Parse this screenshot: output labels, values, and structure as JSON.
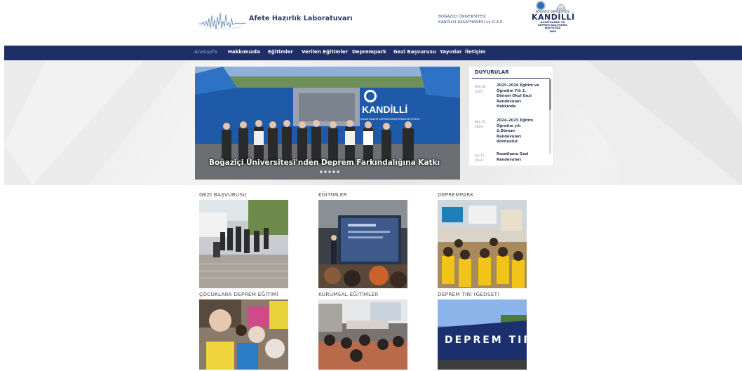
{
  "header": {
    "site_title": "Afete Hazırlık Laboratuvarı",
    "institution_line1": "BOĞAZİÇİ ÜNİVERSİTESİ",
    "institution_line2": "KANDİLLİ RASATHANESİ ve D.A.E.",
    "logo_top": "BOĞAZİÇİ ÜNİVERSİTESİ",
    "logo_main": "KANDİLLİ",
    "logo_sub1": "RASATHANESİ VE",
    "logo_sub2": "DEPREM ARAŞTIRMA",
    "logo_sub3": "ENSTİTÜSÜ",
    "logo_year": "1868"
  },
  "nav": {
    "items": [
      {
        "label": "Anasayfa"
      },
      {
        "label": "Hakkımızda"
      },
      {
        "label": "Eğitimler"
      },
      {
        "label": "Verilen Eğitimler"
      },
      {
        "label": "Deprempark"
      },
      {
        "label": "Gezi Başvurusu"
      },
      {
        "label": "Yayınlar"
      },
      {
        "label": "İletişim"
      }
    ]
  },
  "slider": {
    "caption": "Boğaziçi Üniversitesi'nden Deprem Farkındalığına Katkı",
    "tent_brand": "KANDİLLİ",
    "tent_sub": "RASATHANESİ DEPREM ARAŞTIRMA ENSTİTÜSÜ"
  },
  "announcements": {
    "title": "DUYURULAR",
    "items": [
      {
        "date1": "Tem 02",
        "date2": "2025",
        "text": "2025–2026 Eğitim ve Öğretim Yılı 2. Dönem Okul Gezi Randevuları Hakkında"
      },
      {
        "date1": "Kas 15",
        "date2": "2024",
        "text": "2024–2025 Eğitim Öğretim yılı 2.Dönem Randevuları dolmuştur."
      },
      {
        "date1": "Eyl 11",
        "date2": "2024",
        "text": "Rasathane Gezi Randevuları"
      }
    ]
  },
  "cards": [
    {
      "title": "GEZİ BAŞVURUSU"
    },
    {
      "title": "EĞİTİMLER"
    },
    {
      "title": "DEPREMPARK"
    },
    {
      "title": "ÇOCUKLARA DEPREM EĞİTİMİ"
    },
    {
      "title": "KURUMSAL EĞİTİMLER"
    },
    {
      "title": "DEPREM TIRI (GEDSET)"
    }
  ],
  "truck_text": "DEPREM TIRI",
  "colors": {
    "nav_bg": "#1d2f66",
    "nav_active": "#7fb2f5",
    "accent": "#2d6db3"
  }
}
